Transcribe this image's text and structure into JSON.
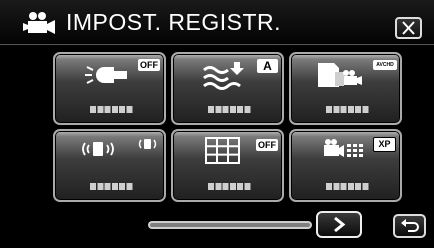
{
  "header": {
    "title": "IMPOST. REGISTR.",
    "mode_icon": "video-camera-icon",
    "close_icon": "close-x-icon"
  },
  "tiles": [
    {
      "name": "light-setting",
      "icon": "video-light-icon",
      "badge": "OFF"
    },
    {
      "name": "wind-cut-setting",
      "icon": "wind-cut-icon",
      "badge": "A"
    },
    {
      "name": "recording-media-setting",
      "icon": "avchd-format-icon",
      "badge": "AVCHD"
    },
    {
      "name": "image-stabilizer-setting",
      "icon": "image-stabilizer-icon",
      "badge": ""
    },
    {
      "name": "grid-display-setting",
      "icon": "grid-icon",
      "badge": "OFF"
    },
    {
      "name": "video-quality-setting",
      "icon": "video-quality-icon",
      "badge": "XP"
    }
  ],
  "footer": {
    "next_icon": "chevron-right-icon",
    "return_icon": "return-arrow-icon"
  },
  "scroll_position": 0.0
}
